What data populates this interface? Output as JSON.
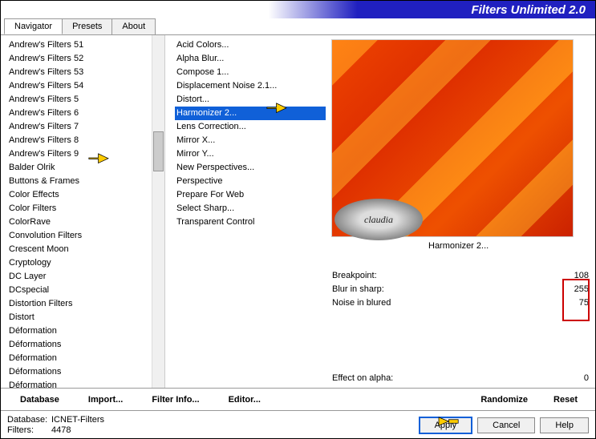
{
  "title": "Filters Unlimited 2.0",
  "tabs": {
    "navigator": "Navigator",
    "presets": "Presets",
    "about": "About"
  },
  "categories": [
    "Andrew's Filters 51",
    "Andrew's Filters 52",
    "Andrew's Filters 53",
    "Andrew's Filters 54",
    "Andrew's Filters 5",
    "Andrew's Filters 6",
    "Andrew's Filters 7",
    "Andrew's Filters 8",
    "Andrew's Filters 9",
    "Balder Olrik",
    "Buttons & Frames",
    "Color Effects",
    "Color Filters",
    "ColorRave",
    "Convolution Filters",
    "Crescent Moon",
    "Cryptology",
    "DC Layer",
    "DCspecial",
    "Distortion Filters",
    "Distort",
    "Déformation",
    "Déformations",
    "Déformation",
    "Déformations",
    "Déformation"
  ],
  "filters": [
    "Acid Colors...",
    "Alpha Blur...",
    "Compose 1...",
    "Displacement Noise 2.1...",
    "Distort...",
    "Harmonizer 2...",
    "Lens Correction...",
    "Mirror X...",
    "Mirror Y...",
    "New Perspectives...",
    "Perspective",
    "Prepare For Web",
    "Select Sharp...",
    "Transparent Control"
  ],
  "selectedFilterIndex": 5,
  "watermark": "claudia",
  "currentFilter": "Harmonizer 2...",
  "params": [
    {
      "label": "Breakpoint:",
      "value": "108"
    },
    {
      "label": "Blur in sharp:",
      "value": "255"
    },
    {
      "label": "Noise in blured",
      "value": "75"
    }
  ],
  "effectAlpha": {
    "label": "Effect on alpha:",
    "value": "0"
  },
  "bar1": {
    "database": "Database",
    "import": "Import...",
    "filterinfo": "Filter Info...",
    "editor": "Editor...",
    "randomize": "Randomize",
    "reset": "Reset"
  },
  "footer": {
    "dbk": "Database:",
    "dbv": "ICNET-Filters",
    "fk": "Filters:",
    "fv": "4478",
    "apply": "Apply",
    "cancel": "Cancel",
    "help": "Help"
  }
}
